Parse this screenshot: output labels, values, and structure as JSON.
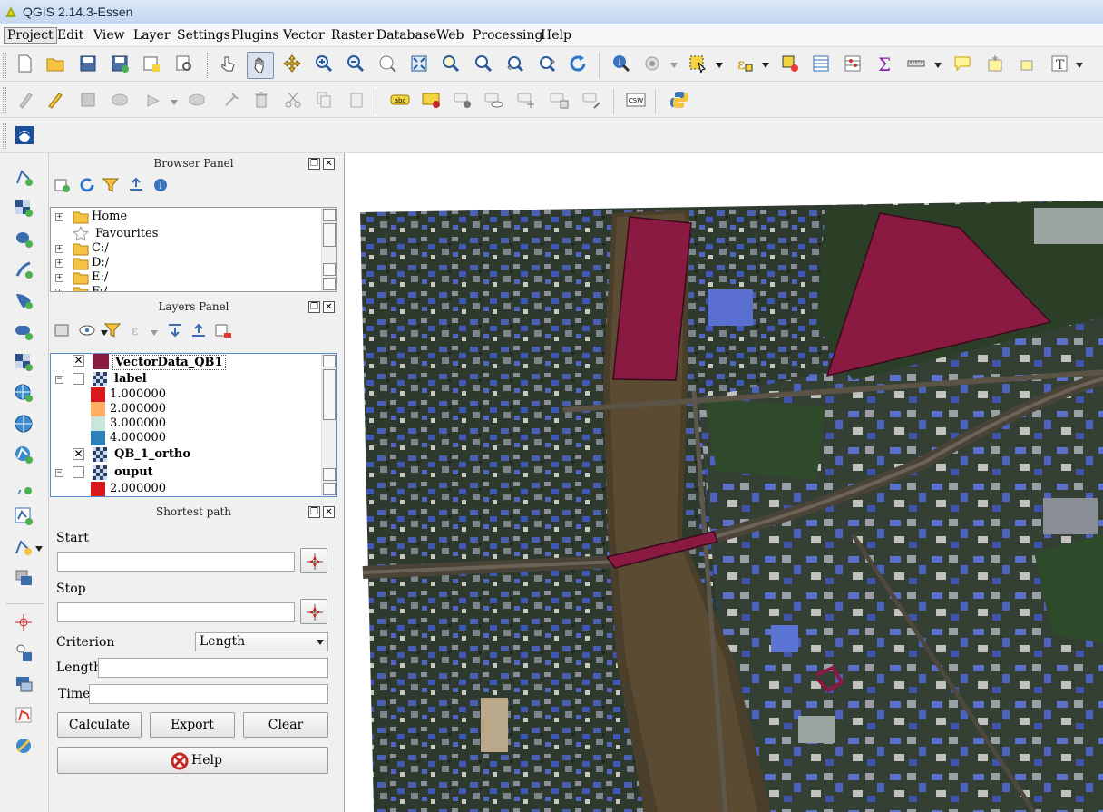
{
  "window": {
    "title": "QGIS 2.14.3-Essen"
  },
  "menu": [
    "Project",
    "Edit",
    "View",
    "Layer",
    "Settings",
    "Plugins",
    "Vector",
    "Raster",
    "Database",
    "Web",
    "Processing",
    "Help"
  ],
  "browser_panel": {
    "title": "Browser Panel",
    "items": [
      "Home",
      "Favourites",
      "C:/",
      "D:/",
      "E:/",
      "F:/"
    ]
  },
  "layers_panel": {
    "title": "Layers Panel",
    "layers": [
      {
        "name": "VectorData_QB1",
        "checked": true,
        "color": "#8b1a42"
      },
      {
        "name": "label",
        "checked": false,
        "classes": [
          {
            "label": "1.000000",
            "color": "#d7191c"
          },
          {
            "label": "2.000000",
            "color": "#fdae61"
          },
          {
            "label": "3.000000",
            "color": "#abdda4"
          },
          {
            "label": "4.000000",
            "color": "#2b83ba"
          }
        ]
      },
      {
        "name": "QB_1_ortho",
        "checked": true
      },
      {
        "name": "ouput",
        "checked": false,
        "classes": [
          {
            "label": "2.000000",
            "color": "#d7191c"
          }
        ]
      }
    ]
  },
  "shortest_path": {
    "title": "Shortest path",
    "start_label": "Start",
    "start_value": "",
    "stop_label": "Stop",
    "stop_value": "",
    "criterion_label": "Criterion",
    "criterion_value": "Length",
    "length_label": "Length",
    "length_value": "",
    "time_label": "Time",
    "time_value": "",
    "calculate": "Calculate",
    "export": "Export",
    "clear": "Clear",
    "help": "Help"
  },
  "colors": {
    "polygon_fill": "#8b1a42",
    "polygon_stroke": "#3b0a1c"
  }
}
